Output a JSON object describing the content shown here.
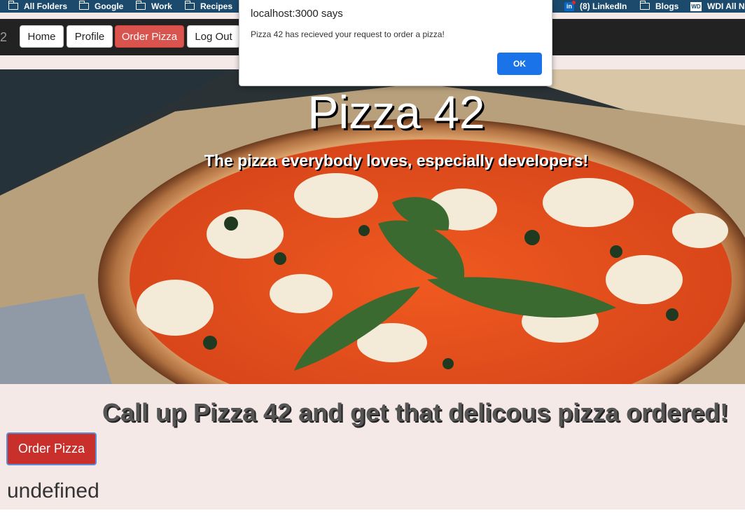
{
  "bookmarks": [
    {
      "label": "All Folders",
      "icon": "folder-icon"
    },
    {
      "label": "Google",
      "icon": "folder-icon"
    },
    {
      "label": "Work",
      "icon": "folder-icon"
    },
    {
      "label": "Recipes",
      "icon": "folder-icon"
    },
    {
      "label": "(8) LinkedIn",
      "icon": "linkedin-icon",
      "badge_text": "in"
    },
    {
      "label": "Blogs",
      "icon": "folder-icon"
    },
    {
      "label": "WDI All No",
      "icon": "wdi-icon",
      "badge_text": "WD"
    }
  ],
  "navbar": {
    "brand_fragment": "2",
    "home": "Home",
    "profile": "Profile",
    "order": "Order Pizza",
    "logout": "Log Out"
  },
  "hero": {
    "title": "Pizza 42",
    "subtitle": "The pizza everybody loves, especially developers!"
  },
  "main": {
    "cta": "Call up Pizza 42 and get that delicous pizza ordered!",
    "order_button": "Order Pizza",
    "result": "undefined"
  },
  "dialog": {
    "title": "localhost:3000 says",
    "message": "Pizza 42 has recieved your request to order a pizza!",
    "ok": "OK"
  },
  "colors": {
    "bookmark_bar": "#1c4a6c",
    "navbar": "#222222",
    "danger": "#d9534f",
    "order_button": "#c9302c",
    "page_bg": "#f5e9e8",
    "dialog_ok": "#1a73e8"
  }
}
